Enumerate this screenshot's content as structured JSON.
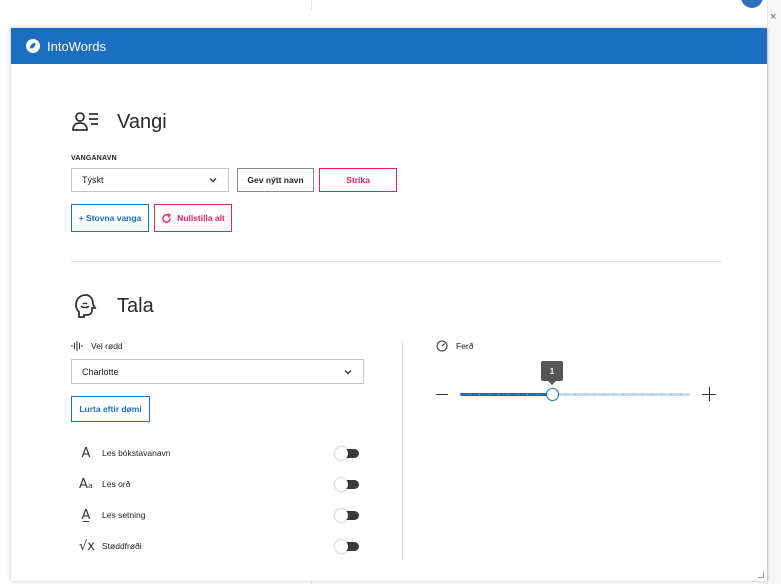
{
  "window": {
    "close_label": "×"
  },
  "app": {
    "title": "IntoWords",
    "brand_color": "#1c6ec2"
  },
  "profile": {
    "heading": "Vangi",
    "field_label": "VANGANAVN",
    "selected_profile": "Týskt",
    "rename_label": "Gev nýtt navn",
    "delete_label": "Strika",
    "create_label": "+ Stovna vanga",
    "reset_label": "Nullstilla alt"
  },
  "speech": {
    "heading": "Tala",
    "voice_label": "Vel rødd",
    "selected_voice": "Charlotte",
    "sample_label": "Lurta eftir dømi",
    "speed_label": "Ferð",
    "speed_value": "1",
    "speed_fraction": 0.4,
    "toggles": [
      {
        "icon": "letter-a-icon",
        "glyph": "A",
        "label": "Les bókstavanavn",
        "on": false
      },
      {
        "icon": "letter-aa-icon",
        "glyph": "Aₐ",
        "label": "Les orð",
        "on": false
      },
      {
        "icon": "sentence-icon",
        "glyph": "A̲",
        "label": "Les setning",
        "on": false
      },
      {
        "icon": "sqrt-icon",
        "glyph": "√x",
        "label": "Støddfrøði",
        "on": false
      }
    ]
  },
  "colors": {
    "accent": "#1c6ec2",
    "danger": "#e0245e"
  }
}
